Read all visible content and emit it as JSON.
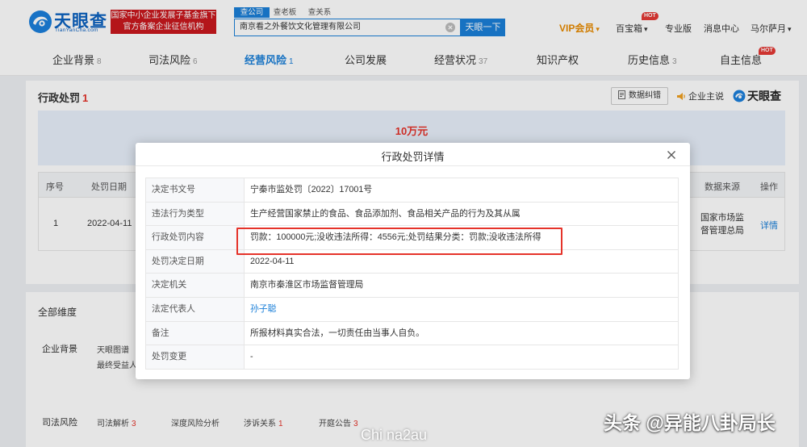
{
  "header": {
    "logo_text": "天眼查",
    "logo_sub": "TianYanCha.com",
    "badge_line1": "国家中小企业发展子基金旗下",
    "badge_line2": "官方备案企业征信机构",
    "search_tabs": [
      "查公司",
      "查老板",
      "查关系"
    ],
    "search_value": "南京看之外餐饮文化管理有限公司",
    "search_button": "天眼一下",
    "vip": "VIP会员",
    "toolbox": "百宝箱",
    "hot": "HOT",
    "pro": "专业版",
    "messages": "消息中心",
    "user": "马尔萨月"
  },
  "nav": [
    {
      "label": "企业背景",
      "count": "8"
    },
    {
      "label": "司法风险",
      "count": "6"
    },
    {
      "label": "经营风险",
      "count": "1"
    },
    {
      "label": "公司发展",
      "count": ""
    },
    {
      "label": "经营状况",
      "count": "37"
    },
    {
      "label": "知识产权",
      "count": ""
    },
    {
      "label": "历史信息",
      "count": "3"
    },
    {
      "label": "自主信息",
      "count": ""
    }
  ],
  "section": {
    "title": "行政处罚",
    "count": "1",
    "correct_button": "数据纠错",
    "owner_says": "企业主说",
    "brand": "天眼查",
    "summary_amount": "10万元"
  },
  "table": {
    "headers": {
      "index": "序号",
      "date": "处罚日期",
      "source": "数据来源",
      "action": "操作"
    },
    "rows": [
      {
        "index": "1",
        "date": "2022-04-11",
        "source": "国家市场监督管理总局",
        "action": "详情"
      }
    ]
  },
  "dimensions": {
    "title": "全部维度",
    "groups": [
      {
        "label": "企业背景",
        "items": [
          {
            "label": "天眼图谱",
            "count": ""
          },
          {
            "label": "最终受益人",
            "count": ""
          }
        ]
      },
      {
        "label": "司法风险",
        "items": [
          {
            "label": "司法解析",
            "count": "3"
          },
          {
            "label": "深度风险分析",
            "count": ""
          },
          {
            "label": "涉诉关系",
            "count": "1"
          },
          {
            "label": "开庭公告",
            "count": "3"
          }
        ]
      }
    ]
  },
  "modal": {
    "title": "行政处罚详情",
    "rows": [
      {
        "label": "决定书文号",
        "value": "宁秦市监处罚〔2022〕17001号"
      },
      {
        "label": "违法行为类型",
        "value": "生产经营国家禁止的食品、食品添加剂、食品相关产品的行为及其从属"
      },
      {
        "label": "行政处罚内容",
        "value": "罚款：100000元;没收违法所得：4556元;处罚结果分类：罚款;没收违法所得"
      },
      {
        "label": "处罚决定日期",
        "value": "2022-04-11"
      },
      {
        "label": "决定机关",
        "value": "南京市秦淮区市场监督管理局"
      },
      {
        "label": "法定代表人",
        "value": "孙子聪"
      },
      {
        "label": "备注",
        "value": "所报材料真实合法，一切责任由当事人自负。"
      },
      {
        "label": "处罚变更",
        "value": "-"
      }
    ]
  },
  "watermarks": {
    "toutiao": "头条 @异能八卦局长",
    "site": "Chi na2au"
  },
  "icons": [
    "tianyancha-logo-icon",
    "clear-icon",
    "chevron-down-icon",
    "document-icon",
    "speaker-icon",
    "close-icon"
  ],
  "colors": {
    "blue": "#1a7fd8",
    "red": "#e5332a",
    "orange": "#e88b00",
    "brand": "#0d62c0"
  }
}
